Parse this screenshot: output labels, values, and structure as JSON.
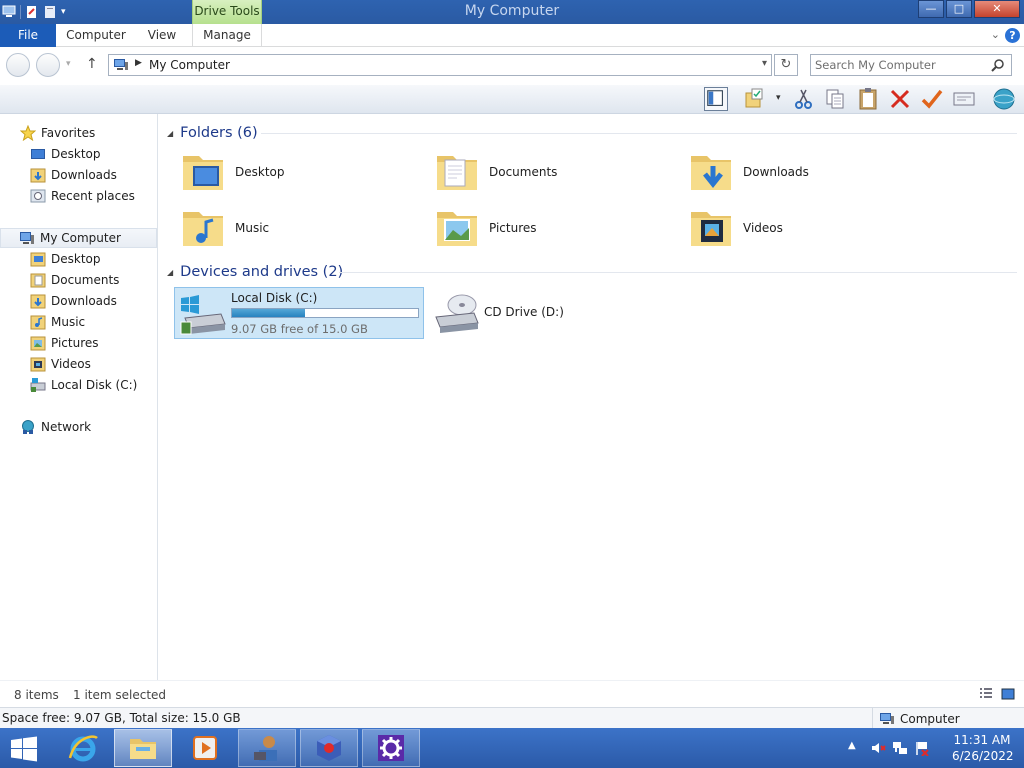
{
  "window": {
    "title": "My Computer",
    "context_tab": "Drive Tools",
    "buttons": {
      "minimize": "—",
      "maximize": "□",
      "close": "✕"
    }
  },
  "ribbon": {
    "tabs": [
      "File",
      "Computer",
      "View",
      "Manage"
    ],
    "collapse_icon": "chevron-down-icon",
    "help_label": "?"
  },
  "address": {
    "path": "My Computer",
    "search_placeholder": "Search My Computer"
  },
  "nav": {
    "favorites": {
      "label": "Favorites",
      "items": [
        "Desktop",
        "Downloads",
        "Recent places"
      ]
    },
    "computer": {
      "label": "My Computer",
      "items": [
        "Desktop",
        "Documents",
        "Downloads",
        "Music",
        "Pictures",
        "Videos",
        "Local Disk (C:)"
      ]
    },
    "network": {
      "label": "Network"
    }
  },
  "content": {
    "folders_header": "Folders (6)",
    "folders": [
      "Desktop",
      "Documents",
      "Downloads",
      "Music",
      "Pictures",
      "Videos"
    ],
    "drives_header": "Devices and drives (2)",
    "drives": [
      {
        "name": "Local Disk (C:)",
        "free_text": "9.07 GB free of 15.0 GB",
        "used_fraction": 0.395
      },
      {
        "name": "CD Drive (D:)"
      }
    ]
  },
  "status": {
    "items_count": "8 items",
    "selected": "1 item selected"
  },
  "details": {
    "space": "Space free: 9.07 GB, Total size: 15.0 GB",
    "location": "Computer"
  },
  "taskbar": {
    "time": "11:31 AM",
    "date": "6/26/2022"
  },
  "colors": {
    "accent": "#1c5cb8",
    "selection": "#cde6f7",
    "header_text": "#1e3a8a",
    "taskbar": "#2b5aa8"
  }
}
